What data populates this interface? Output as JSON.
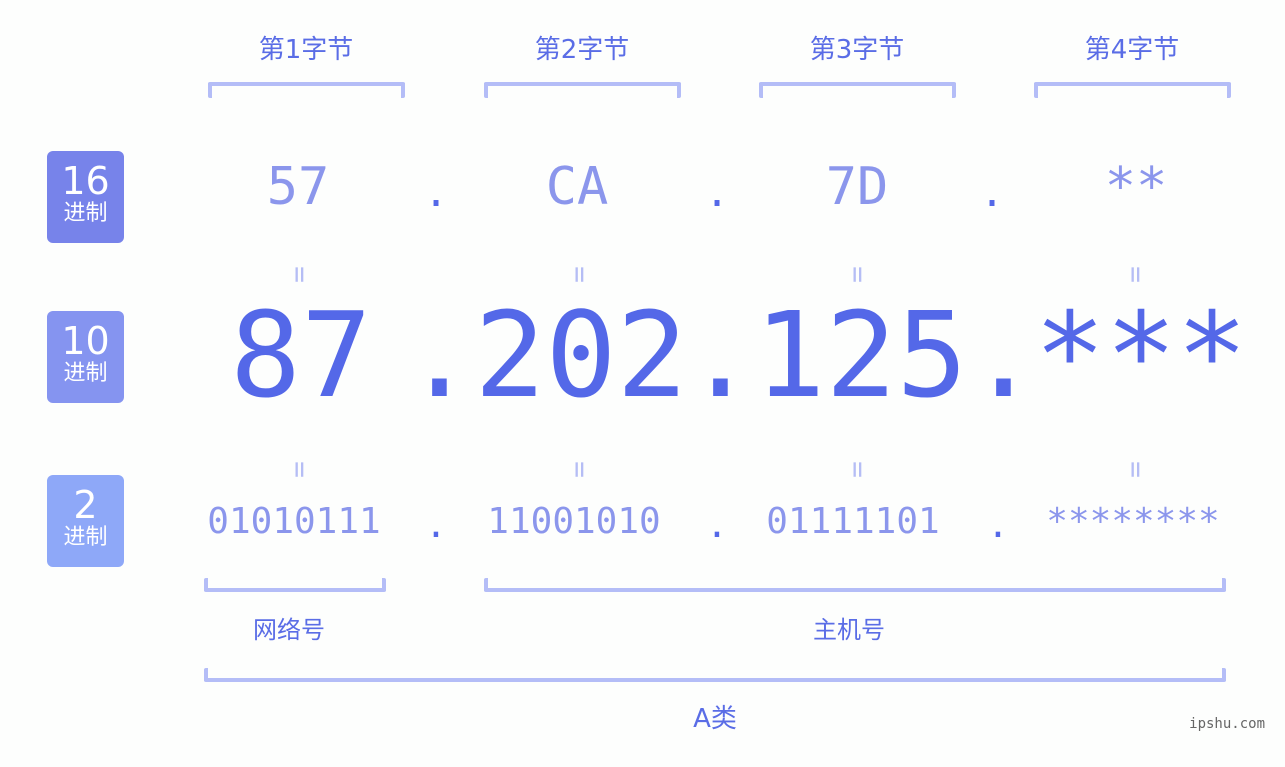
{
  "byte_labels": [
    "第1字节",
    "第2字节",
    "第3字节",
    "第4字节"
  ],
  "rows": {
    "hex": {
      "base": "16",
      "unit": "进制",
      "color": "#7783ea",
      "values": [
        "57",
        "CA",
        "7D",
        "**"
      ]
    },
    "dec": {
      "base": "10",
      "unit": "进制",
      "color": "#8594f0",
      "values": [
        "87",
        "202",
        "125",
        "***"
      ]
    },
    "bin": {
      "base": "2",
      "unit": "进制",
      "color": "#8ea8f8",
      "values": [
        "01010111",
        "11001010",
        "01111101",
        "********"
      ]
    }
  },
  "separator": ".",
  "equals_sign": "=",
  "network_label": "网络号",
  "host_label": "主机号",
  "class_label": "A类",
  "watermark": "ipshu.com"
}
